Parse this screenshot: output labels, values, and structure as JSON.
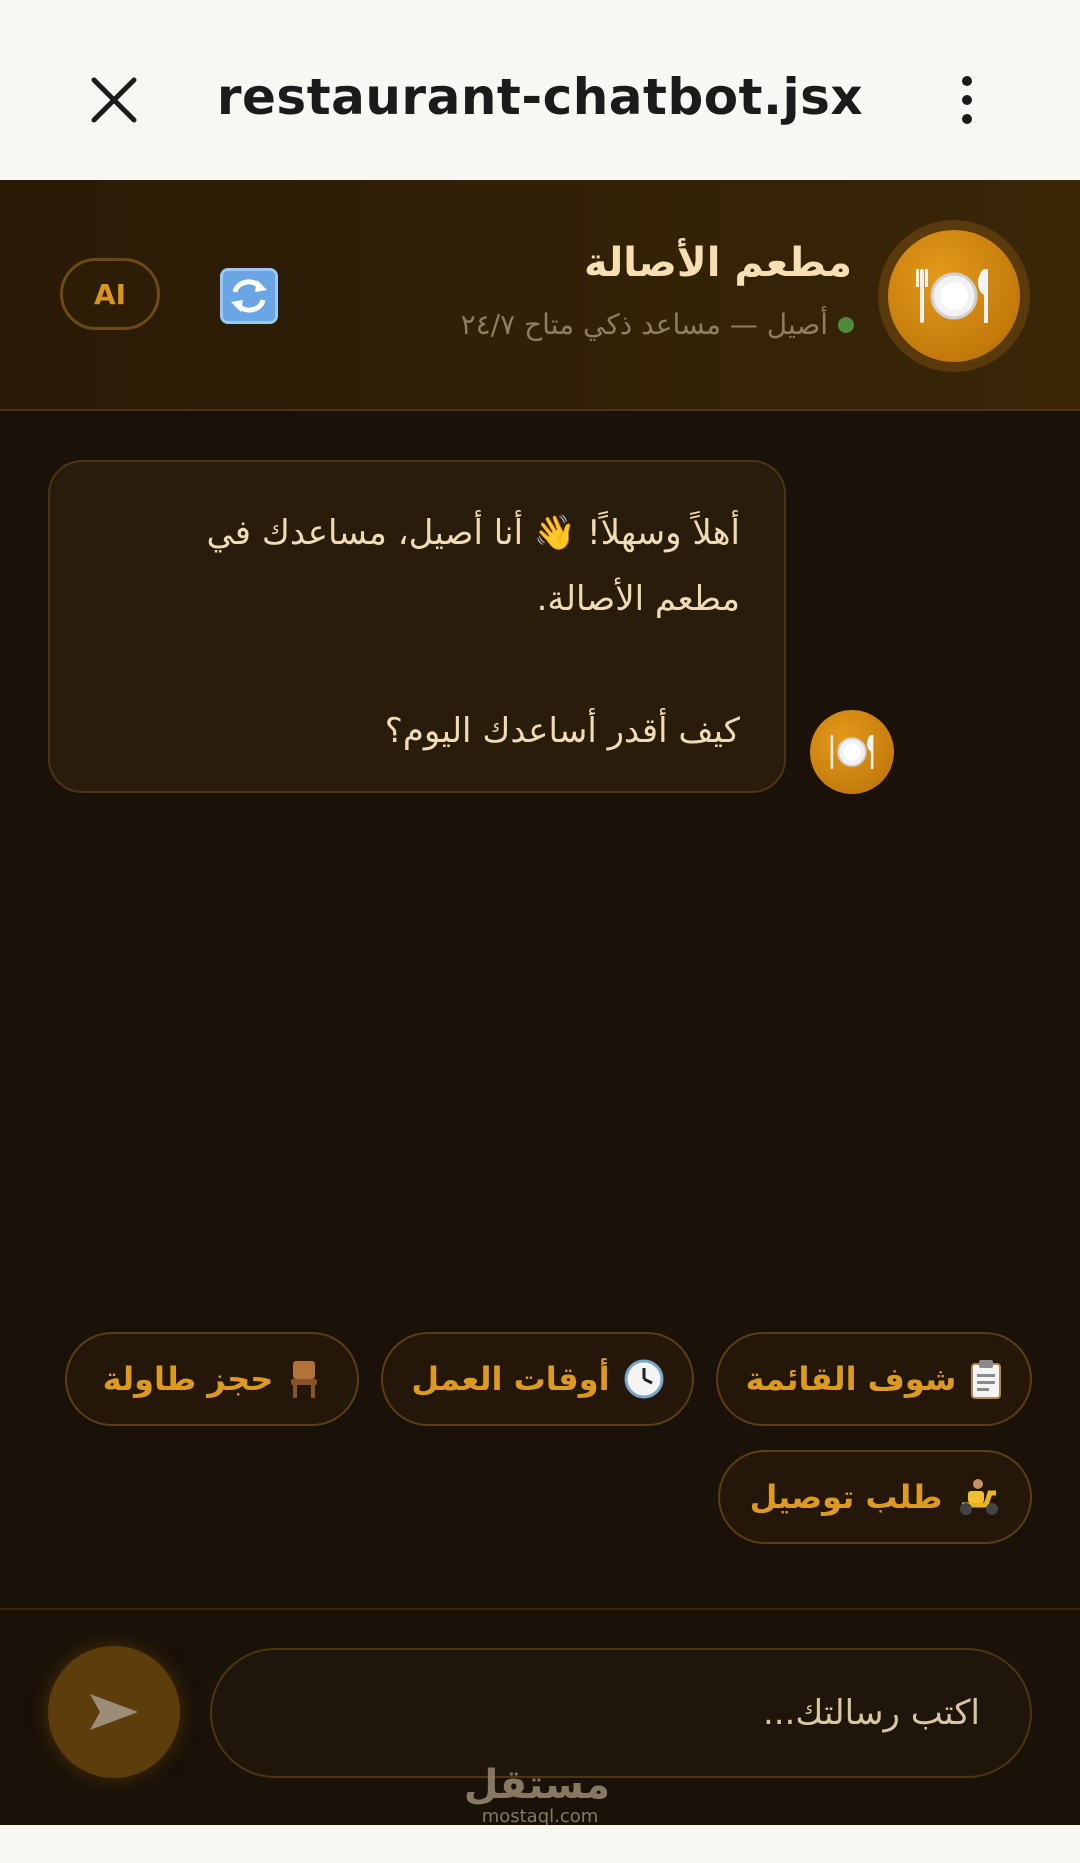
{
  "topbar": {
    "title": "restaurant-chatbot.jsx"
  },
  "header": {
    "restaurant_name": "مطعم الأصالة",
    "status_text": "أصيل — مساعد ذكي متاح ٢٤/٧",
    "ai_badge": "AI",
    "logo_icon": "plate-cutlery-icon",
    "refresh_icon": "refresh-icon"
  },
  "chat": {
    "messages": [
      {
        "sender": "bot",
        "line1": "أهلاً وسهلاً! 👋 أنا أصيل، مساعدك في",
        "line2": "مطعم الأصالة.",
        "line3": "كيف أقدر أساعدك اليوم؟"
      }
    ]
  },
  "quick_replies": [
    {
      "label": "شوف القائمة",
      "icon": "clipboard-icon"
    },
    {
      "label": "أوقات العمل",
      "icon": "clock-icon"
    },
    {
      "label": "حجز طاولة",
      "icon": "chair-icon"
    },
    {
      "label": "طلب توصيل",
      "icon": "scooter-icon"
    }
  ],
  "composer": {
    "placeholder": "اكتب رسالتك..."
  },
  "watermark": {
    "arabic": "مستقل",
    "latin": "mostaql.com"
  },
  "colors": {
    "accent": "#dc9b1f",
    "background": "#1a1108",
    "header": "#3a2607",
    "status_online": "#4f8a3a"
  }
}
